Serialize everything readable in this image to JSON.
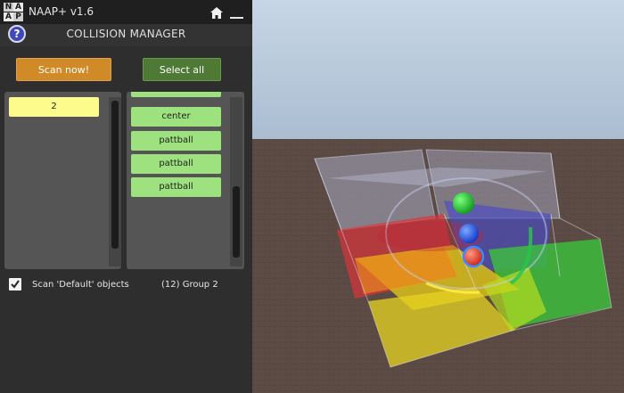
{
  "titlebar": {
    "app_title": "NAAP+ v1.6",
    "logo_letters": [
      "N",
      "A",
      "A",
      "P"
    ],
    "home_icon": "home-icon",
    "minimize_icon": "minimize-icon"
  },
  "header": {
    "help_label": "?",
    "title": "COLLISION MANAGER"
  },
  "buttons": {
    "scan_label": "Scan now!",
    "select_all_label": "Select all"
  },
  "groups_list": {
    "items": [
      "2"
    ]
  },
  "objects_list": {
    "items": [
      "",
      "center",
      "pattball",
      "pattball",
      "pattball"
    ]
  },
  "footer": {
    "scan_default_checked": true,
    "scan_default_label": "Scan 'Default' objects",
    "group_info": "(12) Group 2"
  },
  "colors": {
    "scan_button": "#d08a27",
    "select_all_button": "#4f7a35",
    "group_item": "#fdfb8c",
    "object_item": "#9ee27f",
    "viewport_ground": "#5a4a43"
  }
}
